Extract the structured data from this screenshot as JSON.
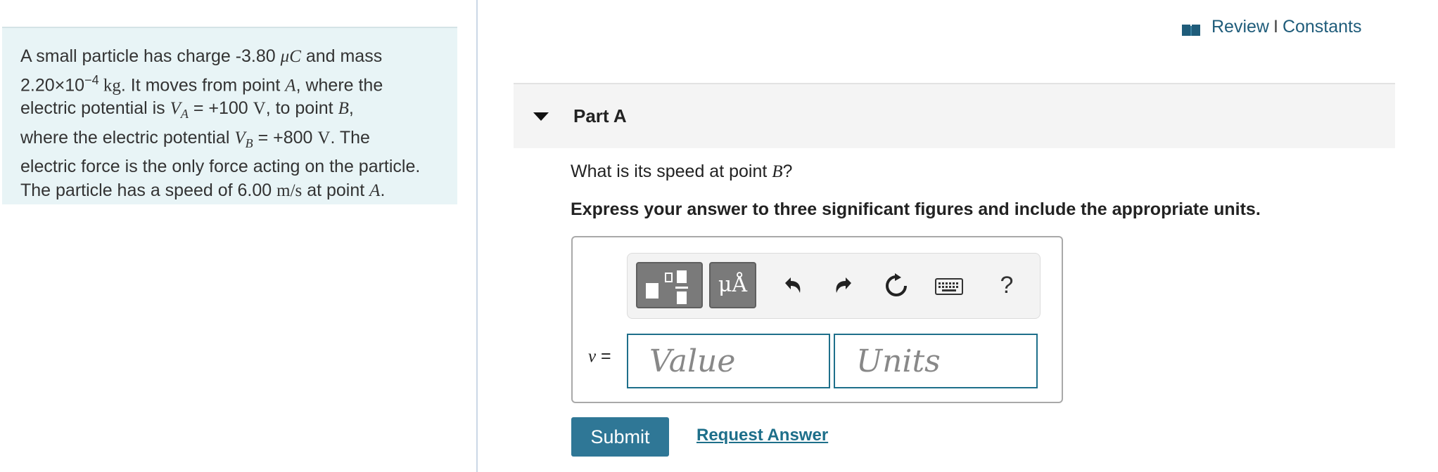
{
  "header": {
    "review_label": "Review",
    "separator": "I",
    "constants_label": "Constants",
    "book_icon": "book-icon"
  },
  "problem": {
    "line1_a": "A small particle has charge -3.80 ",
    "line1_unit": "μC",
    "line1_b": " and mass",
    "line2_mantissa": "2.20×10",
    "line2_exp": "−4",
    "line2_unit": " kg",
    "line2_b": ". It moves from point ",
    "line2_point": "A",
    "line2_c": ", where the",
    "line3_a": "electric potential is ",
    "line3_var": "V",
    "line3_sub": "A",
    "line3_b": " = +100 ",
    "line3_unit": "V",
    "line3_c": ", to point ",
    "line3_point": "B",
    "line3_d": ",",
    "line4_a": "where the electric potential ",
    "line4_var": "V",
    "line4_sub": "B",
    "line4_b": " = +800 ",
    "line4_unit": "V",
    "line4_c": ". The",
    "line5": "electric force is the only force acting on the particle.",
    "line6_a": "The particle has a speed of 6.00 ",
    "line6_unit": "m/s",
    "line6_b": " at point ",
    "line6_point": "A",
    "line6_c": "."
  },
  "part": {
    "title": "Part A",
    "question_a": "What is its speed at point ",
    "question_point": "B",
    "question_b": "?",
    "instructions": "Express your answer to three significant figures and include the appropriate units."
  },
  "toolbar": {
    "units_label": "μÅ",
    "help_label": "?"
  },
  "answer": {
    "variable": "v",
    "equals": " =",
    "value_placeholder": "Value",
    "units_placeholder": "Units"
  },
  "actions": {
    "submit_label": "Submit",
    "request_answer_label": "Request Answer"
  },
  "colors": {
    "problem_bg": "#e8f4f6",
    "accent": "#2f7796",
    "link": "#1f5c7a"
  }
}
